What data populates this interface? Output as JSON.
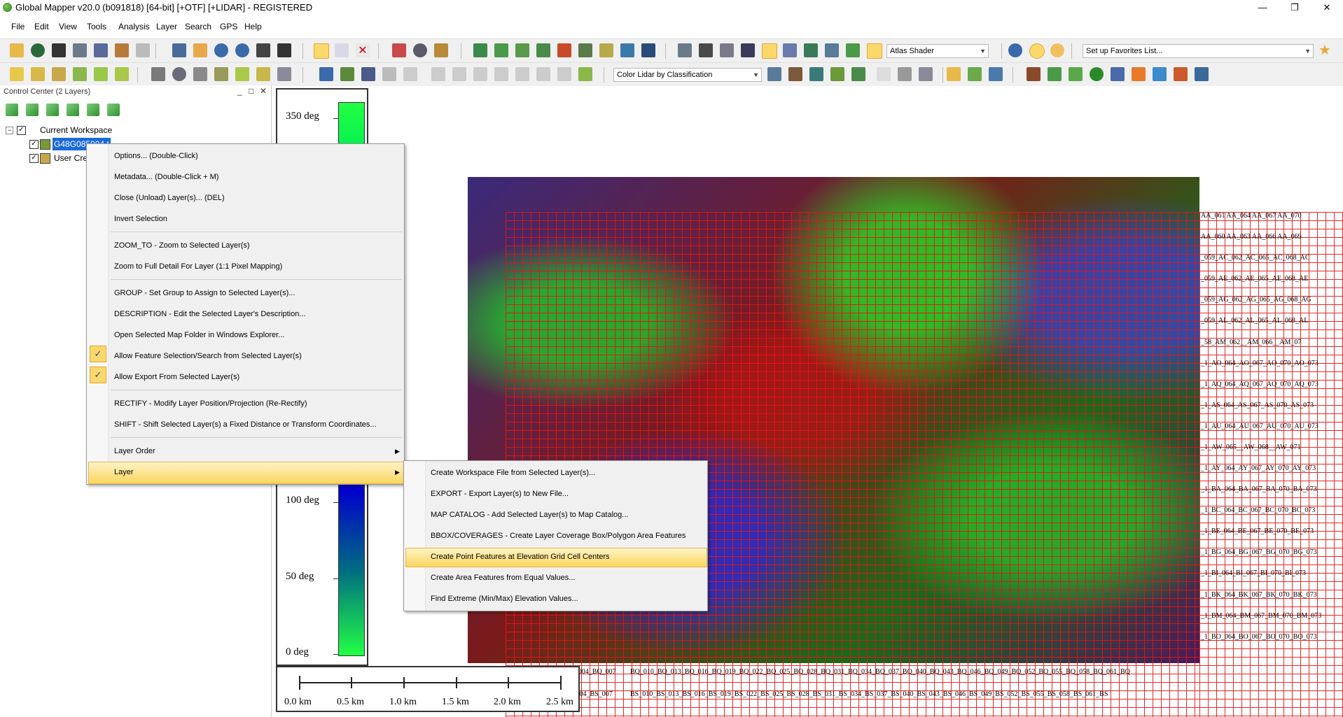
{
  "window": {
    "title": "Global Mapper v20.0 (b091818) [64-bit] [+OTF] [+LIDAR] - REGISTERED",
    "minimize": "—",
    "restore": "❐",
    "close": "✕"
  },
  "menubar": [
    "File",
    "Edit",
    "View",
    "Tools",
    "Analysis",
    "Layer",
    "Search",
    "GPS",
    "Help"
  ],
  "toolbar": {
    "shader": "Atlas Shader",
    "favorites": "Set up Favorites List...",
    "lidar_color": "Color Lidar by Classification"
  },
  "control_center": {
    "title": "Control Center (2 Layers)",
    "min": "_",
    "max": "□",
    "close": "✕",
    "workspace": "Current Workspace",
    "layer1": "G48G085004.t",
    "layer2": "User Cre"
  },
  "legend": {
    "labels": [
      {
        "text": "350 deg",
        "value": 350
      },
      {
        "text": "100 deg",
        "value": 100
      },
      {
        "text": "50 deg",
        "value": 50
      },
      {
        "text": "0 deg",
        "value": 0
      }
    ]
  },
  "scale": {
    "labels": [
      "0.0 km",
      "0.5 km",
      "1.0 km",
      "1.5 km",
      "2.0 km",
      "2.5 km"
    ]
  },
  "context_menu": {
    "items": [
      "Options... (Double-Click)",
      "Metadata... (Double-Click + M)",
      "Close (Unload) Layer(s)... (DEL)",
      "Invert Selection",
      "ZOOM_TO - Zoom to Selected Layer(s)",
      "Zoom to Full Detail For Layer (1:1 Pixel Mapping)",
      "GROUP - Set Group to Assign to Selected Layer(s)...",
      "DESCRIPTION - Edit the Selected Layer's Description...",
      "Open Selected Map Folder in Windows Explorer...",
      "Allow Feature Selection/Search from Selected Layer(s)",
      "Allow Export From Selected Layer(s)",
      "RECTIFY - Modify Layer Position/Projection (Re-Rectify)",
      "SHIFT - Shift Selected Layer(s) a Fixed Distance or Transform Coordinates...",
      "Layer Order",
      "Layer"
    ]
  },
  "submenu": {
    "items": [
      "Create Workspace File from Selected Layer(s)...",
      "EXPORT - Export Layer(s) to New File...",
      "MAP CATALOG - Add Selected Layer(s) to Map Catalog...",
      "BBOX/COVERAGES  - Create Layer Coverage Box/Polygon Area Features",
      "Create Point Features at Elevation Grid Cell Centers",
      "Create Area Features from Equal Values...",
      "Find Extreme (Min/Max) Elevation Values..."
    ]
  },
  "map_labels": {
    "right_cols": [
      "AA_061 AA_064 AA_067 AA_070",
      "AA_060 AA_063 AA_066 AA_069",
      "_059_AC_062_AC_065_AC_068_AC",
      "_059_AE_062_AE_065_AE_068_AE",
      "_059_AG_062_AG_065_AG_068_AG",
      "_059_AL_062_AL_065_AL_068_AL",
      "_58_AM_062__AM_066__AM_07",
      "_1_AO_064_AO_067_AO_070_AO_073",
      "_1_AQ_064_AQ_067_AQ_070_AQ_073",
      "_1_AS_064_AS_067_AS_070_AS_073",
      "_1_AU_064_AU_067_AU_070_AU_073",
      "_1_AW_065__AW_068__AW_071",
      "_1_AY_064_AY_067_AY_070_AY_073",
      "_1_BA_064_BA_067_BA_070_BA_073",
      "_1_BC_064_BC_067_BC_070_BC_073",
      "_1_BE_064_BE_067_BE_070_BE_073",
      "_1_BG_064_BG_067_BG_070_BG_073",
      "_1_BI_064_BI_067_BI_070_BI_073",
      "_1_BK_064_BK_067_BK_070_BK_073",
      "_1_BM_064_BM_067_BM_070_BM_073",
      "_1_BO_064_BO_067_BO_070_BO_073"
    ],
    "bottom_row1": "BQ_010_BQ_013_BQ_016_BQ_019_BQ_022_BQ_025_BQ_028_BQ_031_BQ_034_BQ_037_BQ_040_BQ_043_BQ_046_BQ_049_BQ_052_BQ_055_BQ_058_BQ_061_BQ",
    "bottom_row2": "BS_010_BS_013_BS_016_BS_019_BS_022_BS_025_BS_028_BS_031_BS_034_BS_037_BS_040_BS_043_BS_046_BS_049_BS_052_BS_055_BS_058_BS_061_BS",
    "bottom_left1": "BQ_001_BQ_004_BQ_007",
    "bottom_left2": "BS_001_BS_004_BS_007"
  }
}
